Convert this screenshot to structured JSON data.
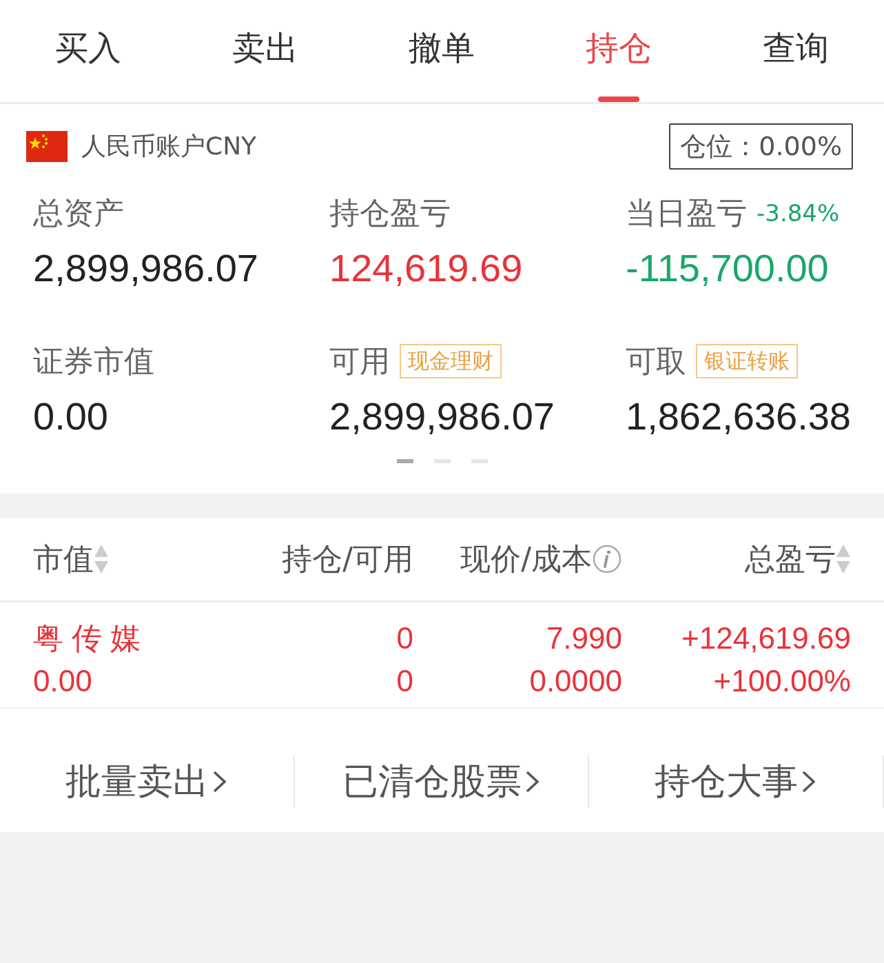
{
  "tabs": [
    {
      "label": "买入",
      "selected": false
    },
    {
      "label": "卖出",
      "selected": false
    },
    {
      "label": "撤单",
      "selected": false
    },
    {
      "label": "持仓",
      "selected": true
    },
    {
      "label": "查询",
      "selected": false
    }
  ],
  "account": {
    "name": "人民币账户CNY",
    "position": "仓位：0.00%"
  },
  "stats": [
    {
      "label": "总资产",
      "value": "2,899,986.07",
      "color": "#222222"
    },
    {
      "label": "持仓盈亏",
      "value": "124,619.69",
      "color": "#e8333a"
    },
    {
      "label": "当日盈亏",
      "change": "-3.84%",
      "value": "-115,700.00",
      "color": "#19a76c"
    },
    {
      "label": "证券市值",
      "value": "0.00",
      "color": "#222222"
    },
    {
      "label": "可用",
      "badge": "现金理财",
      "value": "2,899,986.07",
      "color": "#222222"
    },
    {
      "label": "可取",
      "badge": "银证转账",
      "value": "1,862,636.38",
      "color": "#222222"
    }
  ],
  "pager": [
    {
      "selected": true
    },
    {
      "selected": false
    },
    {
      "selected": false
    }
  ],
  "table": {
    "columns": [
      {
        "label": "市值",
        "kind": "sortable"
      },
      {
        "label": "持仓/可用",
        "kind": "plain"
      },
      {
        "label": "现价/成本",
        "kind": "info"
      },
      {
        "label": "总盈亏",
        "kind": "sortable"
      }
    ],
    "rows": [
      {
        "color": "#e8333a",
        "cells": [
          [
            "粤 传 媒",
            "0.00"
          ],
          [
            "0",
            "0"
          ],
          [
            "7.990",
            "0.0000"
          ],
          [
            "+124,619.69",
            "+100.00%"
          ]
        ]
      }
    ]
  },
  "links": [
    "批量卖出",
    "已清仓股票",
    "持仓大事"
  ]
}
